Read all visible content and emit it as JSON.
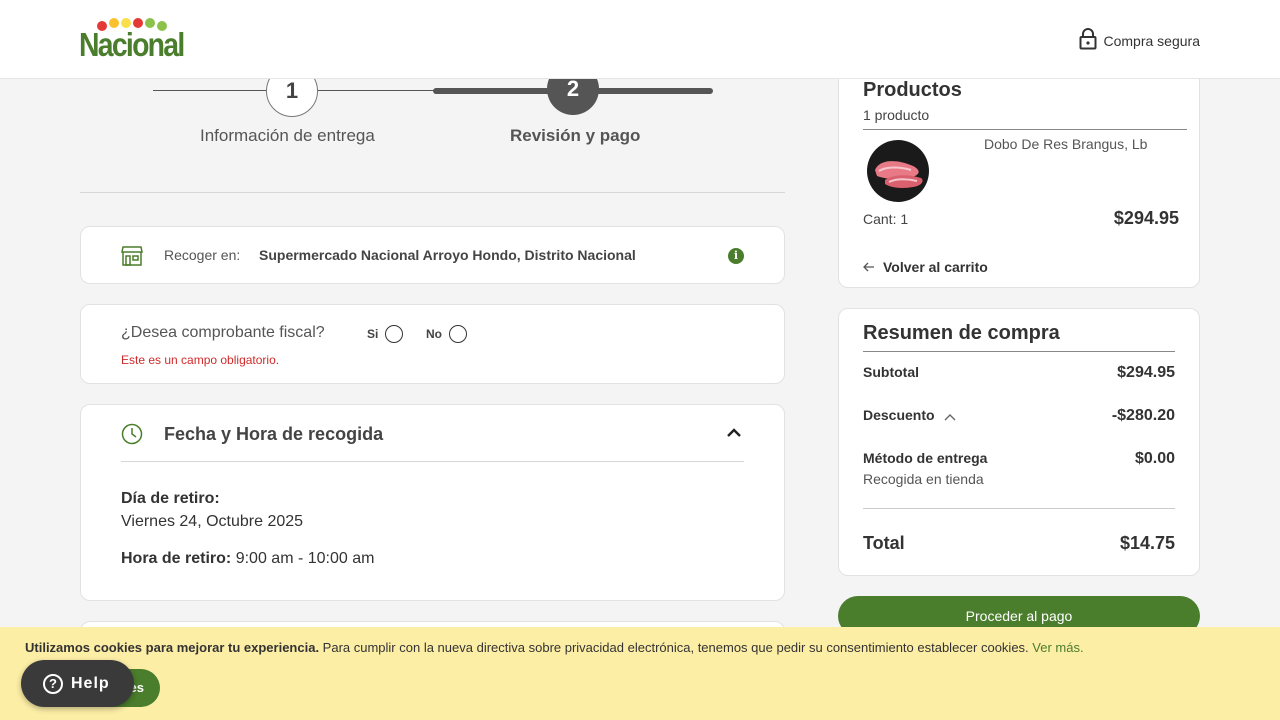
{
  "header": {
    "brand": "Nacional",
    "secure_label": "Compra segura",
    "logo_dot_colors": [
      "#e53935",
      "#fbc02d",
      "#f9e04b",
      "#e53935",
      "#8bc34a",
      "#8bc34a"
    ]
  },
  "stepper": {
    "steps": [
      {
        "number": "1",
        "label": "Información de entrega"
      },
      {
        "number": "2",
        "label": "Revisión y pago"
      }
    ]
  },
  "pickup": {
    "label": "Recoger en:",
    "value": "Supermercado Nacional Arroyo Hondo, Distrito Nacional",
    "info_icon": "i"
  },
  "fiscal": {
    "question": "¿Desea comprobante fiscal?",
    "options": [
      "Si",
      "No"
    ],
    "error": "Este es un campo obligatorio."
  },
  "pickup_time": {
    "title": "Fecha y Hora de recogida",
    "day_label": "Día de retiro:",
    "day_value": "Viernes 24, Octubre 2025",
    "hour_label": "Hora de retiro:",
    "hour_value": "9:00 am - 10:00 am"
  },
  "products": {
    "title": "Productos",
    "count": "1 producto",
    "items": [
      {
        "name": "Dobo De Res Brangus, Lb",
        "qty": "Cant: 1",
        "price": "$294.95"
      }
    ],
    "back_label": "Volver al carrito"
  },
  "summary": {
    "title": "Resumen de compra",
    "subtotal_label": "Subtotal",
    "subtotal_value": "$294.95",
    "discount_label": "Descuento",
    "discount_value": "-$280.20",
    "delivery_label": "Método de entrega",
    "delivery_value": "$0.00",
    "delivery_sub": "Recogida en tienda",
    "total_label": "Total",
    "total_value": "$14.75"
  },
  "proceed_label": "Proceder al pago",
  "cookie": {
    "bold": "Utilizamos cookies para mejorar tu experiencia.",
    "text": " Para cumplir con la nueva directiva sobre privacidad electrónica, tenemos que pedir su consentimiento establecer cookies. ",
    "more": "Ver más.",
    "accept_label_visible": "es"
  },
  "help_label": "Help",
  "colors": {
    "brand_green": "#4a7d2c",
    "error_red": "#d12a2a",
    "cookie_bg": "#fdeea6"
  }
}
